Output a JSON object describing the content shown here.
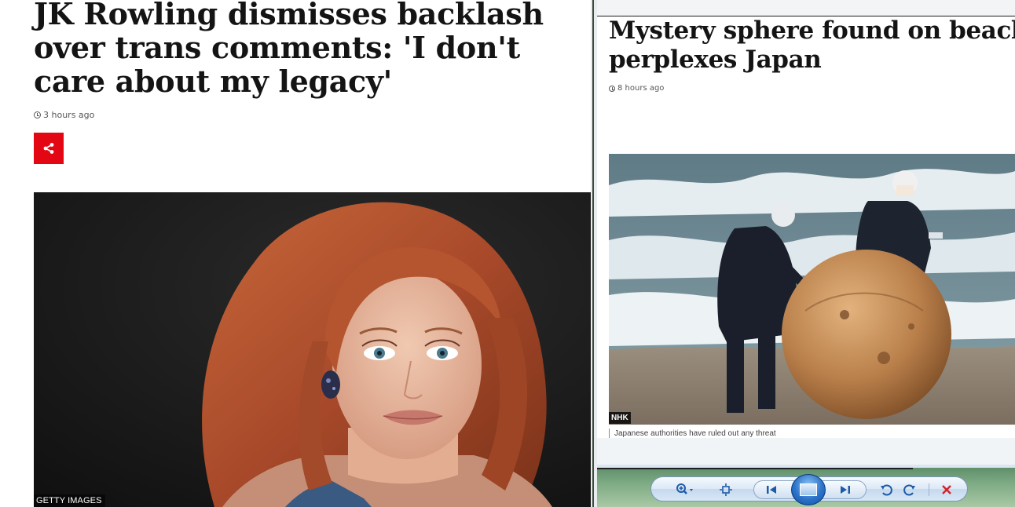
{
  "left_article": {
    "headline": "JK Rowling dismisses backlash over trans comments: 'I don't care about my legacy'",
    "timestamp": "3 hours ago",
    "photo_credit": "GETTY IMAGES",
    "colors": {
      "share_button": "#e30613",
      "headline": "#141414"
    }
  },
  "right_article": {
    "headline_line1": "Mystery sphere found on beach",
    "headline_line2": "perplexes Japan",
    "timestamp": "8 hours ago",
    "photo_badge": "NHK",
    "caption": "Japanese authorities have ruled out any threat"
  },
  "viewer_controls": {
    "icons": [
      "zoom-icon",
      "fit-window-icon",
      "previous-icon",
      "slideshow-icon",
      "next-icon",
      "rotate-counterclockwise-icon",
      "rotate-clockwise-icon",
      "delete-icon"
    ]
  }
}
